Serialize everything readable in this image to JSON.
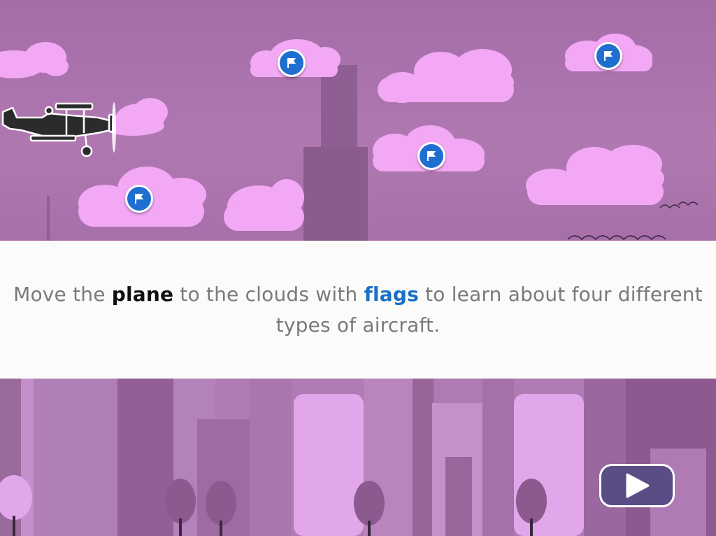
{
  "instruction": {
    "part1": "Move the ",
    "plane_word": "plane",
    "part2": " to the clouds with ",
    "flags_word": "flags",
    "part3": " to learn about four different types of aircraft."
  },
  "colors": {
    "sky": "#a86fa8",
    "cloud": "#f2a8f4",
    "building_dark": "#8a5b8c",
    "flag_button": "#1f6fd1",
    "play_button": "#5a4d86",
    "instruction_text": "#7a7a7a",
    "keyword_plane": "#111111",
    "keyword_flags": "#1a6fc4"
  },
  "icons": {
    "plane": "biplane-silhouette-icon",
    "flag": "flag-icon",
    "play": "play-icon"
  }
}
